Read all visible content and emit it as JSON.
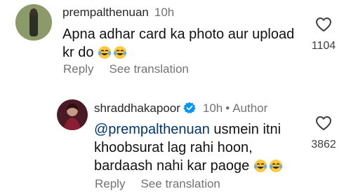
{
  "comments": [
    {
      "username": "prempalthenuan",
      "time": "10h",
      "text": "Apna adhar card ka photo aur upload kr do",
      "text_line1": "Apna adhar card ka photo aur upload",
      "text_line2": "kr do",
      "emoji": "😂😂",
      "likes": "1104",
      "reply_label": "Reply",
      "translate_label": "See translation",
      "avatar_color": "#5a6b3a"
    },
    {
      "username": "shraddhakapoor",
      "verified": true,
      "time": "10h",
      "author_badge": "Author",
      "dot": "•",
      "mention": "@prempalthenuan",
      "text_line1": " usmein itni",
      "text_line2": "khoobsurat lag rahi hoon,",
      "text_line3": "bardaash nahi kar paoge ",
      "emoji": "😂😂",
      "likes": "3862",
      "reply_label": "Reply",
      "translate_label": "See translation",
      "avatar_color": "#6b2030"
    }
  ],
  "colors": {
    "verified_blue": "#0095f6",
    "mention": "#00376b",
    "secondary_text": "#737373"
  }
}
